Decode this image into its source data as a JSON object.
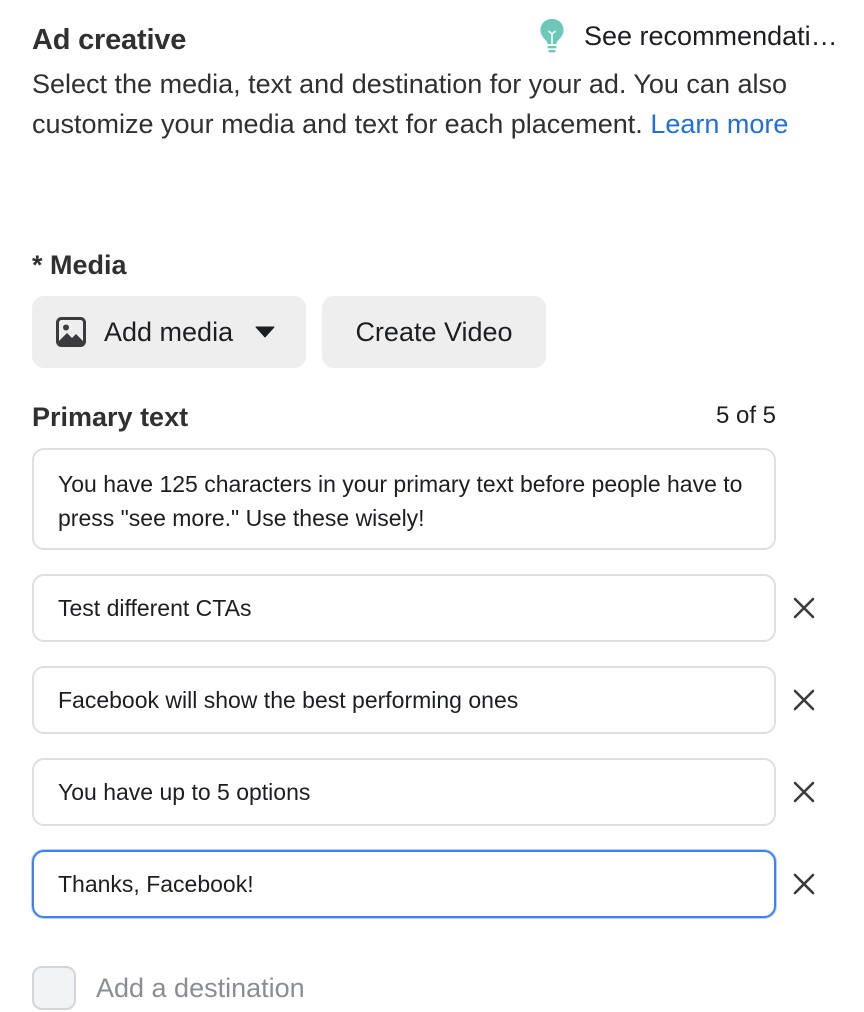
{
  "header": {
    "title": "Ad creative",
    "recommendations_label": "See recommendations"
  },
  "description": {
    "text": "Select the media, text and destination for your ad. You can also customize your media and text for each placement. ",
    "link_label": "Learn more"
  },
  "media": {
    "label": "* Media",
    "add_media_label": "Add media",
    "create_video_label": "Create Video"
  },
  "primary_text": {
    "label": "Primary text",
    "counter": "5 of 5",
    "entries": [
      "You have 125 characters in your primary text before people have to press \"see more.\" Use these wisely!",
      "Test different CTAs",
      "Facebook will show the best performing ones",
      "You have up to 5 options",
      "Thanks, Facebook!"
    ]
  },
  "destination": {
    "label": "Add a destination"
  },
  "icons": {
    "recommendations": "lightbulb-icon",
    "add_media": "image-icon",
    "dropdown": "caret-down-icon",
    "remove": "close-icon"
  },
  "colors": {
    "link": "#216fdb",
    "lightbulb": "#6cc9b8",
    "focus_border": "#4080f0",
    "button_bg": "#eeeeee"
  }
}
